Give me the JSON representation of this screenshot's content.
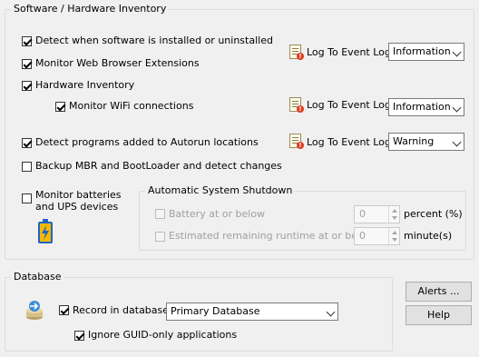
{
  "software_group": {
    "title": "Software / Hardware Inventory",
    "detect_software": {
      "label": "Detect when software is installed or uninstalled",
      "checked": true
    },
    "monitor_browser": {
      "label": "Monitor Web Browser Extensions",
      "checked": true
    },
    "hardware_inventory": {
      "label": "Hardware Inventory",
      "checked": true
    },
    "monitor_wifi": {
      "label": "Monitor WiFi connections",
      "checked": true
    },
    "detect_autorun": {
      "label": "Detect programs added to Autorun locations",
      "checked": true
    },
    "backup_mbr": {
      "label": "Backup MBR and BootLoader and detect changes",
      "checked": false
    },
    "monitor_batteries": {
      "label_line1": "Monitor batteries",
      "label_line2": "and UPS devices",
      "checked": false
    },
    "log_rows": [
      {
        "label": "Log To Event Log:",
        "value": "Information"
      },
      {
        "label": "Log To Event Log:",
        "value": "Information"
      },
      {
        "label": "Log To Event Log:",
        "value": "Warning"
      }
    ]
  },
  "shutdown_group": {
    "title": "Automatic System Shutdown",
    "battery": {
      "label": "Battery at or below",
      "value": "0",
      "unit": "percent (%)",
      "checked": false
    },
    "runtime": {
      "label": "Estimated remaining runtime at or below",
      "value": "0",
      "unit": "minute(s)",
      "checked": false
    }
  },
  "database_group": {
    "title": "Database",
    "record": {
      "label": "Record in database",
      "checked": true
    },
    "database_select": "Primary Database",
    "ignore_guid": {
      "label": "Ignore GUID-only applications",
      "checked": true
    }
  },
  "buttons": {
    "alerts": "Alerts ...",
    "help": "Help"
  },
  "colors": {
    "background": "#f0f0f0",
    "battery_fill": "#f5b800",
    "battery_body": "#1e64c8"
  }
}
